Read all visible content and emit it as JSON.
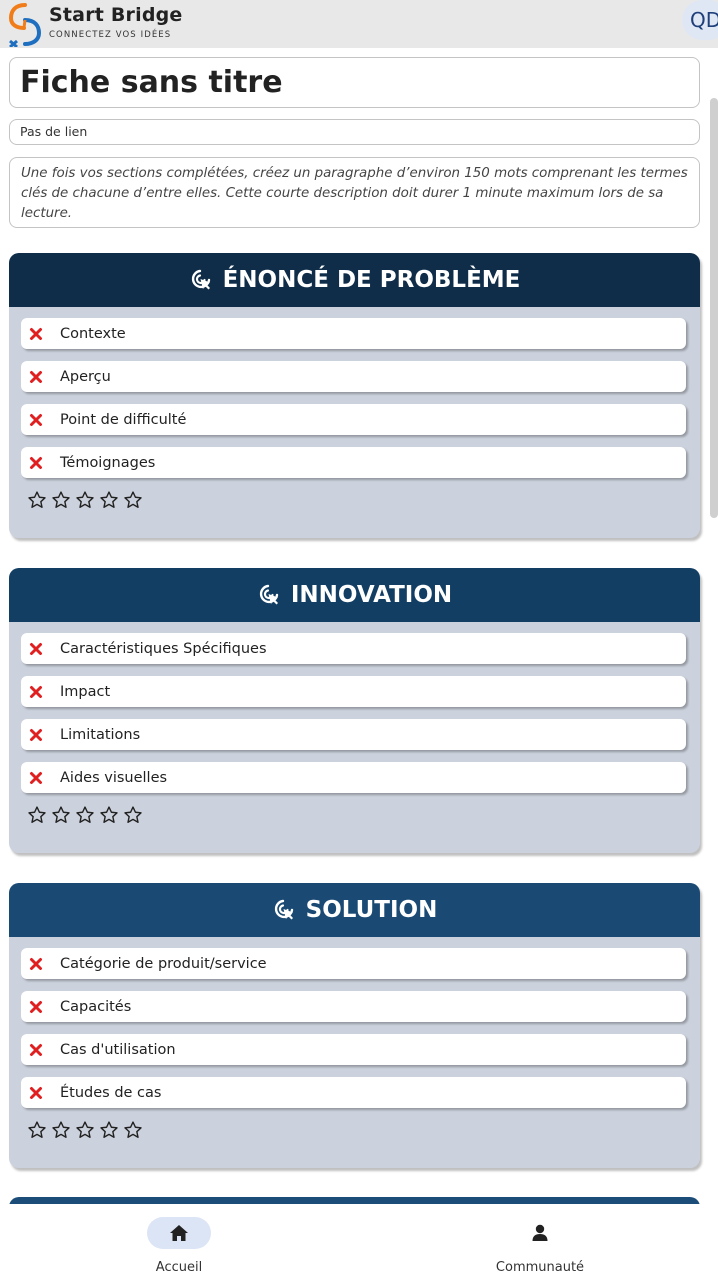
{
  "header": {
    "logo_name": "Start Bridge",
    "logo_tagline": "CONNECTEZ VOS IDÉES",
    "user_initials": "QD"
  },
  "sheet": {
    "title": "Fiche sans titre",
    "link": "Pas de lien",
    "description": "Une fois vos sections complétées, créez un paragraphe d’environ 150 mots comprenant les termes clés de chacune d’entre elles. Cette courte description doit durer 1 minute maximum lors de sa lecture."
  },
  "sections": [
    {
      "title": "ÉNONCÉ DE PROBLÈME",
      "header_color": "#0f2d49",
      "items": [
        "Contexte",
        "Aperçu",
        "Point de difficulté",
        "Témoignages"
      ],
      "rating": 0
    },
    {
      "title": "INNOVATION",
      "header_color": "#133e63",
      "items": [
        "Caractéristiques Spécifiques",
        "Impact",
        "Limitations",
        "Aides visuelles"
      ],
      "rating": 0
    },
    {
      "title": "SOLUTION",
      "header_color": "#1a4a74",
      "items": [
        "Catégorie de produit/service",
        "Capacités",
        "Cas d'utilisation",
        "Études de cas"
      ],
      "rating": 0
    }
  ],
  "nav": {
    "home_label": "Accueil",
    "community_label": "Communauté",
    "active": "home"
  },
  "colors": {
    "incomplete_icon": "#e02020",
    "logo_orange": "#f07d1a",
    "logo_blue": "#1f6fc0"
  },
  "icons": {
    "section_icon": "cursor-click-icon",
    "item_status": "x-icon",
    "rating": "star-outline-icon",
    "home": "home-icon",
    "community": "user-icon"
  }
}
